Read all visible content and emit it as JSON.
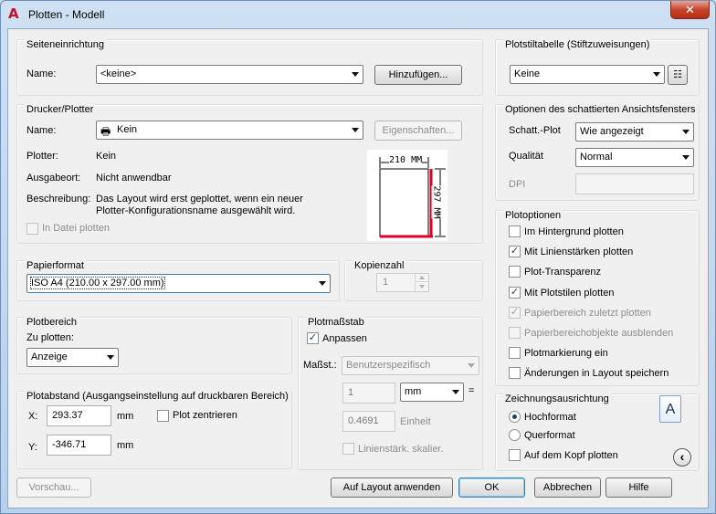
{
  "window": {
    "title": "Plotten - Modell",
    "close_glyph": "✕"
  },
  "page_setup": {
    "title": "Seiteneinrichtung",
    "name_label": "Name:",
    "name_value": "<keine>",
    "add_button": "Hinzufügen..."
  },
  "printer": {
    "title": "Drucker/Plotter",
    "name_label": "Name:",
    "name_value": "Kein",
    "properties_button": "Eigenschaften...",
    "plotter_label": "Plotter:",
    "plotter_value": "Kein",
    "output_label": "Ausgabeort:",
    "output_value": "Nicht anwendbar",
    "description_label": "Beschreibung:",
    "description_line1": "Das Layout wird erst geplottet, wenn ein neuer",
    "description_line2": "Plotter-Konfigurationsname ausgewählt wird.",
    "plot_to_file": "In Datei plotten",
    "preview_width": "210 MM",
    "preview_height": "297 MM"
  },
  "paper_size": {
    "title": "Papierformat",
    "value": "ISO A4 (210.00 x 297.00 mm)"
  },
  "copies": {
    "title": "Kopienzahl",
    "value": "1"
  },
  "plot_area": {
    "title": "Plotbereich",
    "what_label": "Zu plotten:",
    "what_value": "Anzeige"
  },
  "plot_offset": {
    "title": "Plotabstand (Ausgangseinstellung auf druckbaren Bereich)",
    "x_label": "X:",
    "x_value": "293.37",
    "x_unit": "mm",
    "y_label": "Y:",
    "y_value": "-346.71",
    "y_unit": "mm",
    "center_label": "Plot zentrieren"
  },
  "plot_scale": {
    "title": "Plotmaßstab",
    "fit_label": "Anpassen",
    "scale_label": "Maßst.:",
    "scale_value": "Benutzerspezifisch",
    "value1": "1",
    "unit_value": "mm",
    "equals": "=",
    "value2": "0.4691",
    "unit2_label": "Einheit",
    "lineweights_label": "Linienstärk. skalier."
  },
  "plot_style_table": {
    "title": "Plotstiltabelle (Stiftzuweisungen)",
    "value": "Keine"
  },
  "shaded_viewport": {
    "title": "Optionen des schattierten Ansichtsfensters",
    "shade_label": "Schatt.-Plot",
    "shade_value": "Wie angezeigt",
    "quality_label": "Qualität",
    "quality_value": "Normal",
    "dpi_label": "DPI"
  },
  "plot_options": {
    "title": "Plotoptionen",
    "items": [
      {
        "label": "Im Hintergrund plotten",
        "checked": "",
        "disabled": false
      },
      {
        "label": "Mit Linienstärken plotten",
        "checked": "✓",
        "disabled": false
      },
      {
        "label": "Plot-Transparenz",
        "checked": "",
        "disabled": false
      },
      {
        "label": "Mit Plotstilen plotten",
        "checked": "✓",
        "disabled": false
      },
      {
        "label": "Papierbereich zuletzt plotten",
        "checked": "✓",
        "disabled": true
      },
      {
        "label": "Papierbereichobjekte ausblenden",
        "checked": "",
        "disabled": true
      },
      {
        "label": "Plotmarkierung ein",
        "checked": "",
        "disabled": false
      },
      {
        "label": "Änderungen in Layout speichern",
        "checked": "",
        "disabled": false
      }
    ]
  },
  "orientation": {
    "title": "Zeichnungsausrichtung",
    "portrait": "Hochformat",
    "landscape": "Querformat",
    "upside_down": "Auf dem Kopf plotten",
    "icon_letter": "A"
  },
  "footer": {
    "preview": "Vorschau...",
    "apply": "Auf Layout anwenden",
    "ok": "OK",
    "cancel": "Abbrechen",
    "help": "Hilfe",
    "collapse_glyph": "‹"
  }
}
